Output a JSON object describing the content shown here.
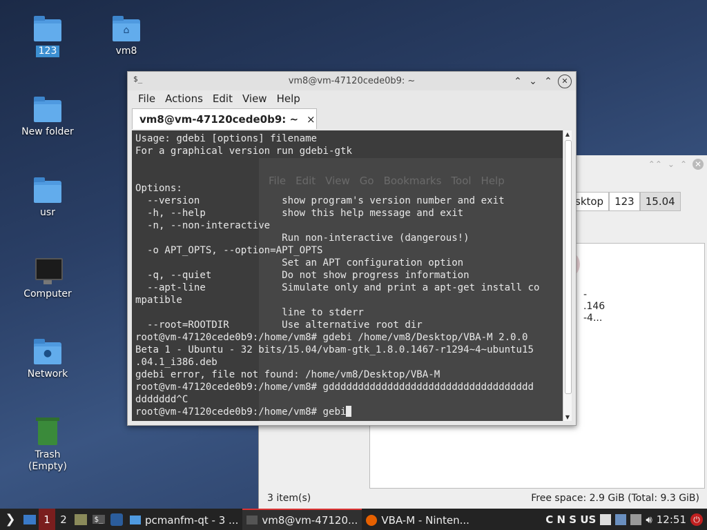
{
  "desktop": {
    "icons": [
      {
        "label": "123"
      },
      {
        "label": "vm8"
      },
      {
        "label": "New folder"
      },
      {
        "label": "usr"
      },
      {
        "label": "Computer"
      },
      {
        "label": "Network"
      },
      {
        "label": "Trash"
      },
      {
        "label": "(Empty)"
      }
    ]
  },
  "file_manager": {
    "ghost_menu": [
      "File",
      "Edit",
      "View",
      "Go",
      "Bookmarks",
      "Tool",
      "Help"
    ],
    "path_tabs": [
      "sktop",
      "123",
      "15.04"
    ],
    "item_text": [
      "-",
      ".146",
      "-4..."
    ],
    "status_left": "3 item(s)",
    "status_right": "Free space: 2.9 GiB (Total: 9.3 GiB)"
  },
  "terminal": {
    "title": "vm8@vm-47120cede0b9: ~",
    "menu": [
      "File",
      "Actions",
      "Edit",
      "View",
      "Help"
    ],
    "tab_label": "vm8@vm-47120cede0b9: ~",
    "tab_close": "×",
    "lines": [
      "Usage: gdebi [options] filename",
      "For a graphical version run gdebi-gtk",
      "",
      "",
      "Options:",
      "  --version              show program's version number and exit",
      "  -h, --help             show this help message and exit",
      "  -n, --non-interactive",
      "                         Run non-interactive (dangerous!)",
      "  -o APT_OPTS, --option=APT_OPTS",
      "                         Set an APT configuration option",
      "  -q, --quiet            Do not show progress information",
      "  --apt-line             Simulate only and print a apt-get install co",
      "mpatible",
      "                         line to stderr",
      "  --root=ROOTDIR         Use alternative root dir",
      "root@vm-47120cede0b9:/home/vm8# gdebi /home/vm8/Desktop/VBA-M 2.0.0",
      "Beta 1 - Ubuntu - 32 bits/15.04/vbam-gtk_1.8.0.1467-r1294~4~ubuntu15",
      ".04.1_i386.deb",
      "gdebi error, file not found: /home/vm8/Desktop/VBA-M",
      "root@vm-47120cede0b9:/home/vm8# gddddddddddddddddddddddddddddddddddd",
      "ddddddd^C"
    ],
    "prompt": "root@vm-47120cede0b9:/home/vm8# gebi"
  },
  "taskbar": {
    "start_icon": "❯",
    "desktops": [
      "1",
      "2"
    ],
    "tasks": [
      {
        "label": "pcmanfm-qt - 3 ...",
        "icon": "folder-icon"
      },
      {
        "label": "vm8@vm-47120...",
        "icon": "terminal-icon"
      },
      {
        "label": "VBA-M - Ninten...",
        "icon": "firefox-icon"
      }
    ],
    "keyboard": "C N S US",
    "clock": "12:51"
  }
}
